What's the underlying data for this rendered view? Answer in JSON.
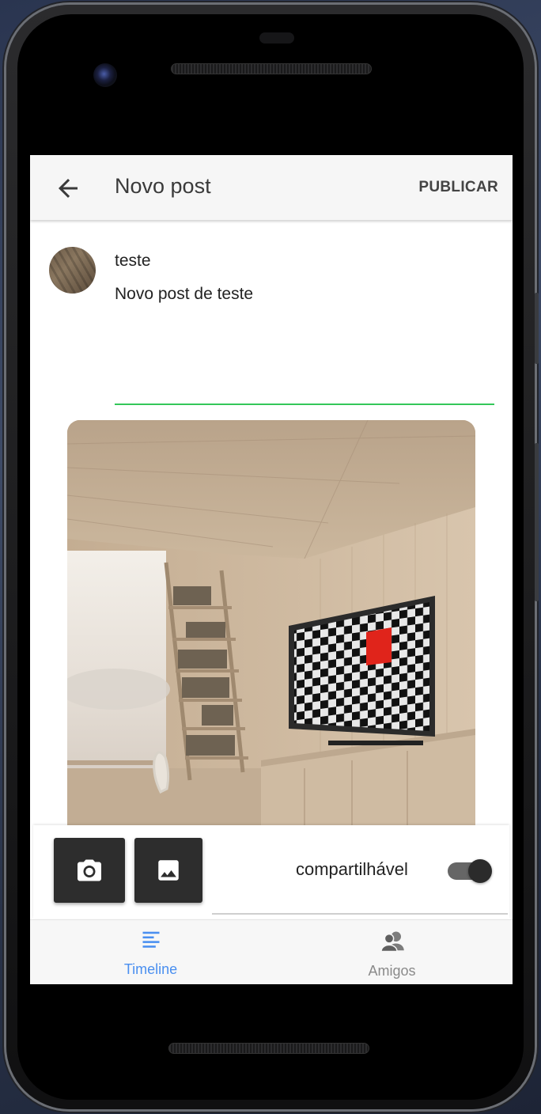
{
  "appbar": {
    "title": "Novo post",
    "publish_label": "PUBLICAR"
  },
  "post": {
    "username": "teste",
    "text": "Novo post de teste"
  },
  "bottom_panel": {
    "share_label": "compartilhável",
    "share_enabled": true
  },
  "navigation": {
    "items": [
      {
        "label": "Timeline",
        "icon": "timeline-icon",
        "active": true
      },
      {
        "label": "Amigos",
        "icon": "friends-icon",
        "active": false
      }
    ]
  },
  "colors": {
    "accent": "#4a8ff0",
    "input_underline": "#34c759",
    "inactive": "#8a8a8a"
  }
}
